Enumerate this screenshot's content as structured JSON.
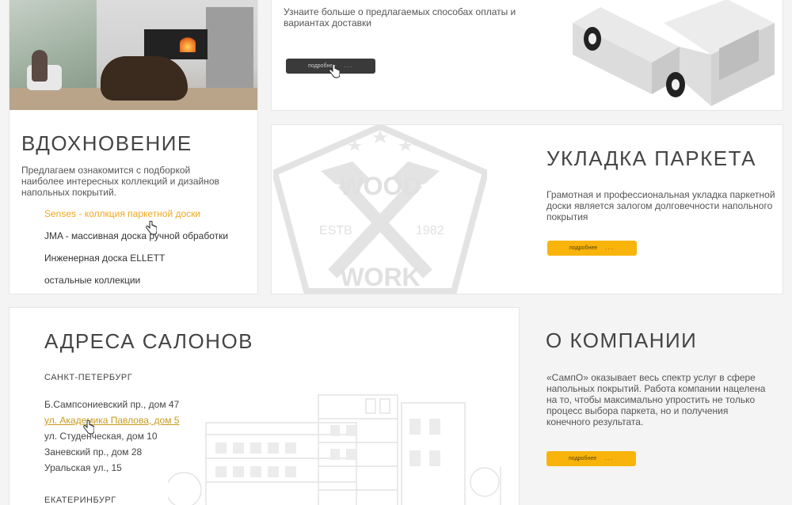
{
  "inspiration": {
    "title": "ВДОХНОВЕНИЕ",
    "description": "Предлагаем ознакомится с подборкой наиболее интересных коллекций и дизайнов напольных покрытий.",
    "collections": [
      "Senses - коллкция паркетной доски",
      "JMA - массивная доска ручной обработки",
      "Инженерная доска ELLETT",
      "остальные коллекции"
    ]
  },
  "delivery": {
    "description": "Узнаите больше о предлагаемых способах оплаты и вариантах доставки",
    "button_label": "подробнее"
  },
  "parquet": {
    "title": "УКЛАДКА ПАРКЕТА",
    "description": "Грамотная и профессиональная укладка паркетной доски является залогом долговечности напольного покрытия",
    "button_label": "подробнее",
    "emblem": {
      "word_top": "WOOD",
      "word_bottom": "WORK",
      "left_text": "ESTB",
      "right_text": "1982"
    }
  },
  "addresses": {
    "title": "АДРЕСА САЛОНОВ",
    "cities": [
      {
        "name": "САНКТ-ПЕТЕРБУРГ",
        "addresses": [
          "Б.Сампсониевский пр., дом 47",
          "ул. Академика Павлова, дом 5",
          "ул. Студенческая, дом 10",
          "Заневский пр., дом 28",
          "Уральская ул., 15"
        ]
      },
      {
        "name": "ЕКАТЕРИНБУРГ"
      }
    ]
  },
  "company": {
    "title": "О КОМПАНИИ",
    "description": "«СампО» оказывает весь спектр услуг в сфере напольных покрытий. Работа компании нацелена на то, чтобы максимально упростить не только процесс выбора паркета, но и получения конечного результата.",
    "button_label": "подробнее"
  },
  "colors": {
    "accent": "#f8b40b",
    "link": "#f0a81c",
    "dark_button": "#3a3a3a"
  }
}
